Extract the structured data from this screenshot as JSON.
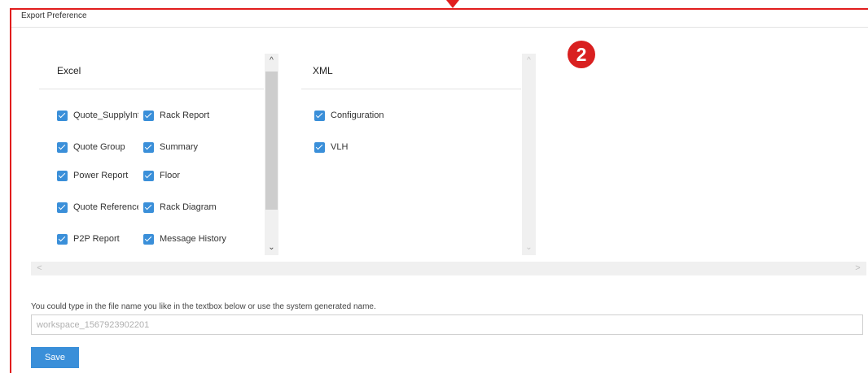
{
  "dialog": {
    "title": "Export Preference"
  },
  "annotation": {
    "badge_number": "2",
    "color": "#d92020"
  },
  "excel": {
    "heading": "Excel",
    "column_a": [
      {
        "label": "Quote_SupplyInfo",
        "checked": true
      },
      {
        "label": "Quote Group",
        "checked": true
      },
      {
        "label": "Power Report",
        "checked": true
      },
      {
        "label": "Quote Reference",
        "checked": true
      },
      {
        "label": "P2P Report",
        "checked": true
      }
    ],
    "column_b": [
      {
        "label": "Rack Report",
        "checked": true
      },
      {
        "label": "Summary",
        "checked": true
      },
      {
        "label": "Floor",
        "checked": true
      },
      {
        "label": "Rack Diagram",
        "checked": true
      },
      {
        "label": "Message History",
        "checked": true
      }
    ]
  },
  "xml": {
    "heading": "XML",
    "items": [
      {
        "label": "Configuration",
        "checked": true
      },
      {
        "label": "VLH",
        "checked": true
      }
    ]
  },
  "scroll": {
    "up_icon": "^",
    "down_icon": "⌄",
    "left_icon": "<",
    "right_icon": ">"
  },
  "filename": {
    "instruction": "You could type in the file name you like in the textbox below or use the system generated name.",
    "placeholder": "workspace_1567923902201"
  },
  "actions": {
    "save_label": "Save"
  },
  "colors": {
    "accent": "#3a8fd9",
    "frame": "#e11d1d"
  }
}
